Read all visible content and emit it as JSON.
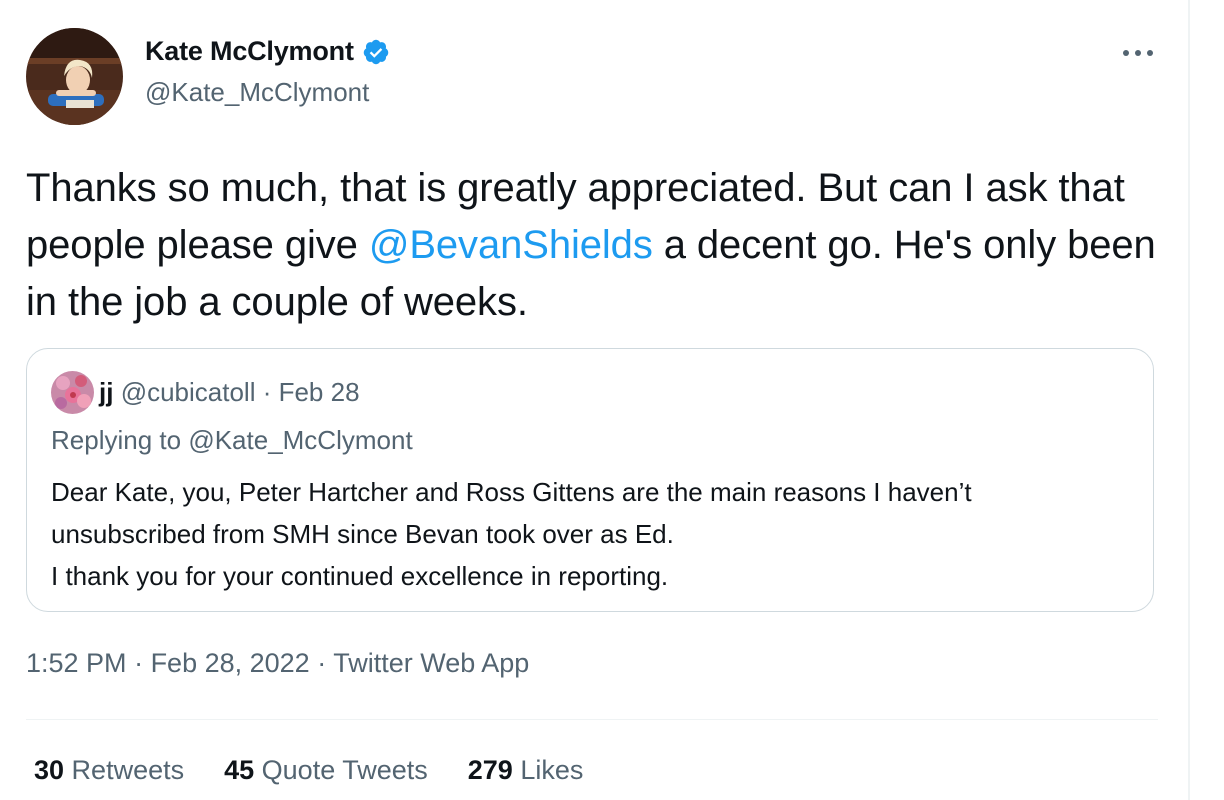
{
  "author": {
    "name": "Kate McClymont",
    "handle": "@Kate_McClymont",
    "verified_icon": "verified-badge-icon"
  },
  "tweet": {
    "text_before": "Thanks so much, that is greatly appreciated. But can I ask that people please give ",
    "mention": "@BevanShields",
    "text_after": " a decent go. He's only been in the job a couple of weeks."
  },
  "quoted": {
    "name": "jj",
    "handle": "@cubicatoll",
    "separator": " · ",
    "date": "Feb 28",
    "replying_prefix": "Replying to ",
    "replying_to": "@Kate_McClymont",
    "lines": [
      "Dear Kate, you, Peter Hartcher and Ross Gittens are the main reasons I haven’t",
      "unsubscribed from SMH since Bevan took over as Ed.",
      "I thank you for your continued excellence in reporting."
    ]
  },
  "meta": {
    "time": "1:52 PM",
    "sep": " · ",
    "date": "Feb 28, 2022",
    "client": "Twitter Web App"
  },
  "stats": {
    "retweets_count": "30",
    "retweets_label": " Retweets",
    "quotes_count": "45",
    "quotes_label": " Quote Tweets",
    "likes_count": "279",
    "likes_label": " Likes"
  },
  "colors": {
    "accent": "#1d9bf0",
    "secondary_text": "#536471",
    "border": "#cfd9de"
  }
}
